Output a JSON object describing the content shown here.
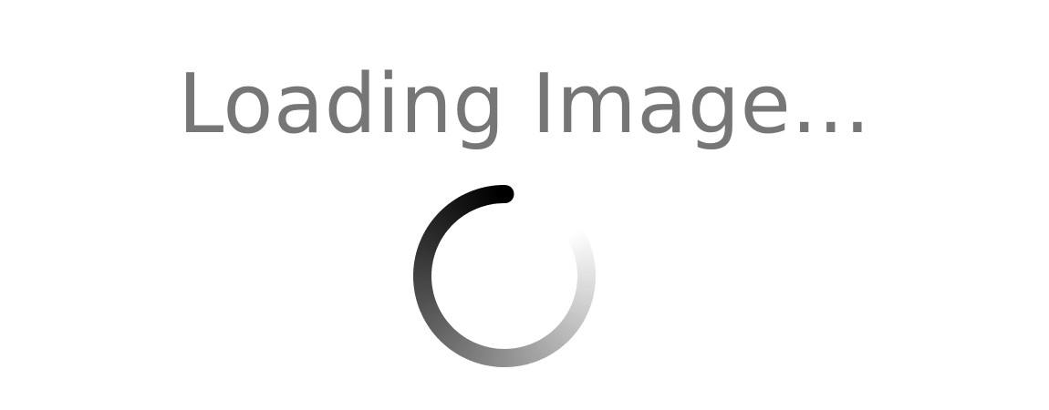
{
  "loading": {
    "message": "Loading Image..."
  },
  "spinner": {
    "icon": "loading-spinner-icon",
    "color_head": "#000000",
    "color_tail": "#ffffff"
  }
}
